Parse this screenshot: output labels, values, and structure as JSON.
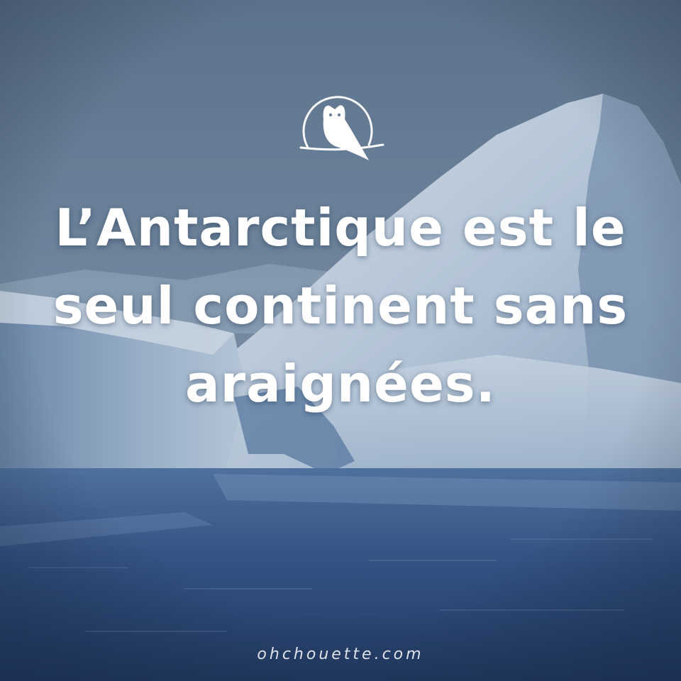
{
  "image": {
    "scene": "iceberg-seascape",
    "colors": {
      "sky": "#6e8299",
      "ice": "#e6eef6",
      "ice_shadow": "#8ea6c2",
      "water_light": "#4a6c98",
      "water_dark": "#1b3563",
      "text": "#ffffff"
    }
  },
  "logo": {
    "icon": "owl-logo-icon"
  },
  "headline": {
    "line1": "L’Antarctique est le",
    "line2": "seul continent sans",
    "line3": "araignées."
  },
  "footer": {
    "site": "ohchouette.com"
  }
}
